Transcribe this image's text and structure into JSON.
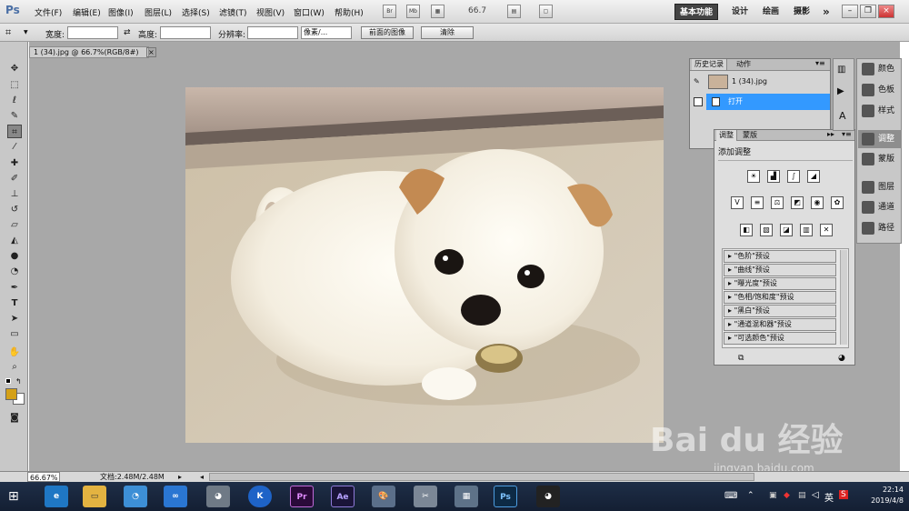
{
  "app": {
    "logo": "Ps"
  },
  "menu": [
    "文件(F)",
    "编辑(E)",
    "图像(I)",
    "图层(L)",
    "选择(S)",
    "滤镜(T)",
    "视图(V)",
    "窗口(W)",
    "帮助(H)"
  ],
  "menubar_icons": {
    "bridge": "Br",
    "mini_bridge": "Mb",
    "zoom": "66.7"
  },
  "workspaces": {
    "basic": "基本功能",
    "design": "设计",
    "paint": "绘画",
    "photo": "摄影",
    "more": "»"
  },
  "options": {
    "width_label": "宽度:",
    "height_label": "高度:",
    "resolution_label": "分辨率:",
    "unit_select": "像素/...",
    "front_image_button": "前面的图像",
    "clear_button": "清除"
  },
  "document": {
    "tab_title": "1 (34).jpg @ 66.7%(RGB/8#)",
    "close": "×"
  },
  "history_panel": {
    "tabs": [
      "历史记录",
      "动作"
    ],
    "snapshot_name": "1 (34).jpg",
    "steps": [
      "打开"
    ]
  },
  "adjustments_panel": {
    "tabs": [
      "调整",
      "蒙版"
    ],
    "heading": "添加调整",
    "presets": [
      "\"色阶\"预设",
      "\"曲线\"预设",
      "\"曝光度\"预设",
      "\"色相/饱和度\"预设",
      "\"黑白\"预设",
      "\"通道混和器\"预设",
      "\"可选颜色\"预设"
    ]
  },
  "dock": [
    {
      "label": "颜色",
      "icon": "color-icon"
    },
    {
      "label": "色板",
      "icon": "swatches-icon"
    },
    {
      "label": "样式",
      "icon": "styles-icon"
    },
    {
      "label": "调整",
      "icon": "adjustments-icon"
    },
    {
      "label": "蒙版",
      "icon": "masks-icon"
    },
    {
      "label": "图层",
      "icon": "layers-icon"
    },
    {
      "label": "通道",
      "icon": "channels-icon"
    },
    {
      "label": "路径",
      "icon": "paths-icon"
    }
  ],
  "status": {
    "zoom": "66.67%",
    "doc_size": "文档:2.48M/2.48M"
  },
  "taskbar": {
    "apps": [
      "ie-icon",
      "explorer-icon",
      "browser-icon",
      "baidu-netdisk-icon",
      "raccoon-icon",
      "k-icon",
      "Pr",
      "Ae",
      "paint-icon",
      "capture-icon",
      "calculator-icon",
      "Ps",
      "qq-icon"
    ],
    "ime": "英",
    "time": "22:14",
    "date": "2019/4/8"
  },
  "watermark": {
    "logo": "Bai du 经验",
    "url": "jingyan.baidu.com"
  },
  "colors": {
    "accent": "#3399ff",
    "fg_swatch": "#d4a017",
    "taskbar": "#1a263d"
  }
}
